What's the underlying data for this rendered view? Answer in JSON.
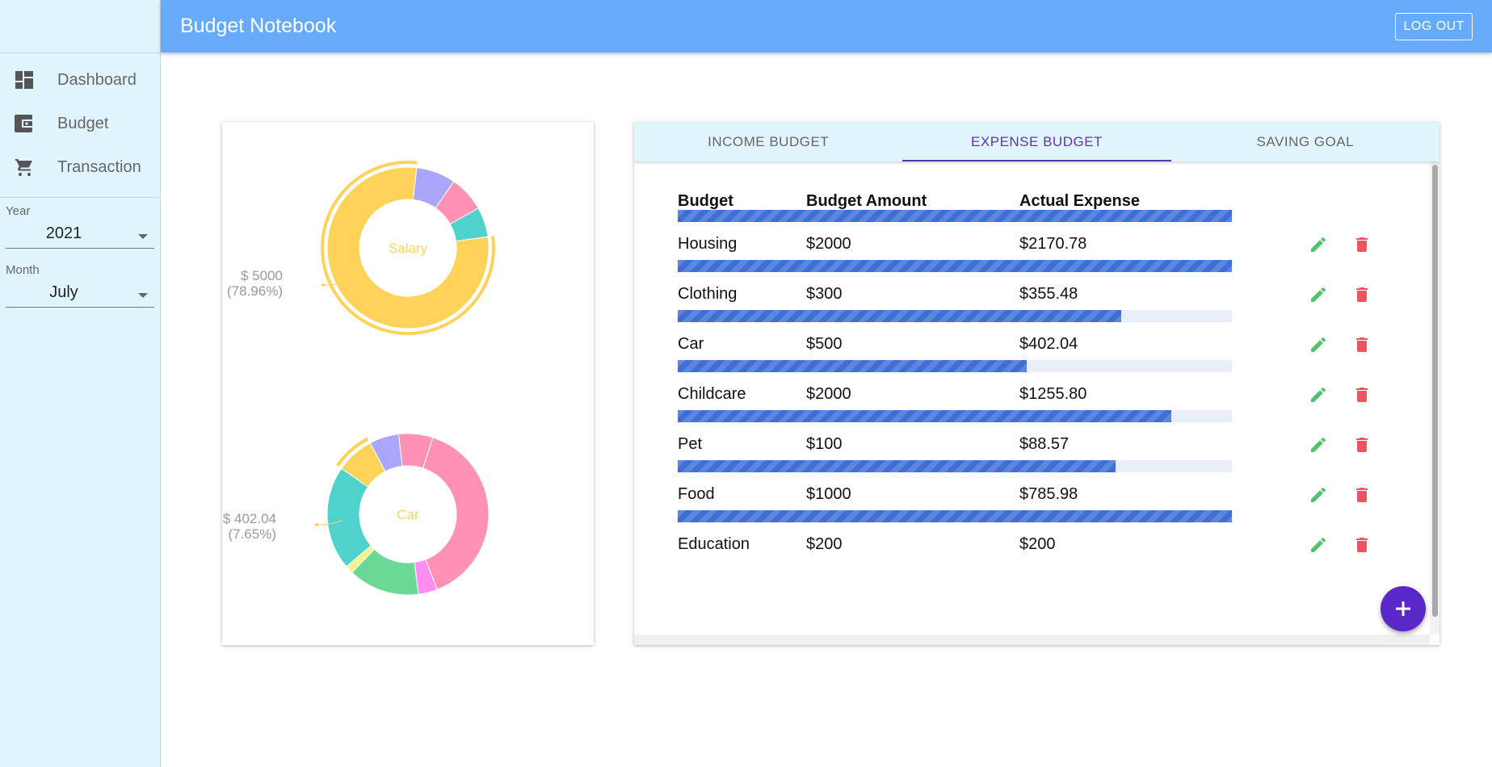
{
  "app": {
    "title": "Budget Notebook",
    "logout_label": "LOG OUT"
  },
  "sidebar": {
    "items": [
      {
        "label": "Dashboard",
        "icon": "dashboard-icon"
      },
      {
        "label": "Budget",
        "icon": "wallet-icon"
      },
      {
        "label": "Transaction",
        "icon": "cart-icon"
      }
    ],
    "year_label": "Year",
    "year_value": "2021",
    "month_label": "Month",
    "month_value": "July"
  },
  "colors": {
    "accent": "#5e35b1",
    "topbar": "#66aaf9",
    "sidebar": "#e1f5fe",
    "progress": "#3f6fd6",
    "edit": "#4fc46e",
    "delete": "#ef5360",
    "fab": "#5c27c9"
  },
  "chart_data": [
    {
      "type": "pie",
      "center_label": "Salary",
      "highlight_label": "$ 5000",
      "highlight_percent": "(78.96%)",
      "slices": [
        {
          "value": 78.96,
          "color": "#ffd25a"
        },
        {
          "value": 7.9,
          "color": "#aaa6fb"
        },
        {
          "value": 7.2,
          "color": "#ff91b7"
        },
        {
          "value": 5.94,
          "color": "#4fd2cc"
        }
      ]
    },
    {
      "type": "pie",
      "center_label": "Car",
      "highlight_label": "$ 402.04",
      "highlight_percent": "(7.65%)",
      "slices": [
        {
          "value": 39.1,
          "color": "#ff91b7"
        },
        {
          "value": 3.8,
          "color": "#ff8ef0"
        },
        {
          "value": 14.3,
          "color": "#6bd896"
        },
        {
          "value": 1.6,
          "color": "#f4f28a"
        },
        {
          "value": 20.8,
          "color": "#4fd2cc"
        },
        {
          "value": 7.65,
          "color": "#ffd25a"
        },
        {
          "value": 5.9,
          "color": "#aaa6fb"
        },
        {
          "value": 6.85,
          "color": "#ff91b7"
        }
      ]
    }
  ],
  "tabs": [
    {
      "label": "INCOME BUDGET"
    },
    {
      "label": "EXPENSE BUDGET"
    },
    {
      "label": "SAVING GOAL"
    }
  ],
  "table": {
    "headers": [
      "Budget",
      "Budget Amount",
      "Actual Expense"
    ],
    "rows": [
      {
        "name": "Housing",
        "amount": "$2000",
        "actual": "$2170.78",
        "progress": 1.0
      },
      {
        "name": "Clothing",
        "amount": "$300",
        "actual": "$355.48",
        "progress": 1.0
      },
      {
        "name": "Car",
        "amount": "$500",
        "actual": "$402.04",
        "progress": 0.8
      },
      {
        "name": "Childcare",
        "amount": "$2000",
        "actual": "$1255.80",
        "progress": 0.63
      },
      {
        "name": "Pet",
        "amount": "$100",
        "actual": "$88.57",
        "progress": 0.89
      },
      {
        "name": "Food",
        "amount": "$1000",
        "actual": "$785.98",
        "progress": 0.79
      },
      {
        "name": "Education",
        "amount": "$200",
        "actual": "$200",
        "progress": 1.0
      }
    ]
  }
}
